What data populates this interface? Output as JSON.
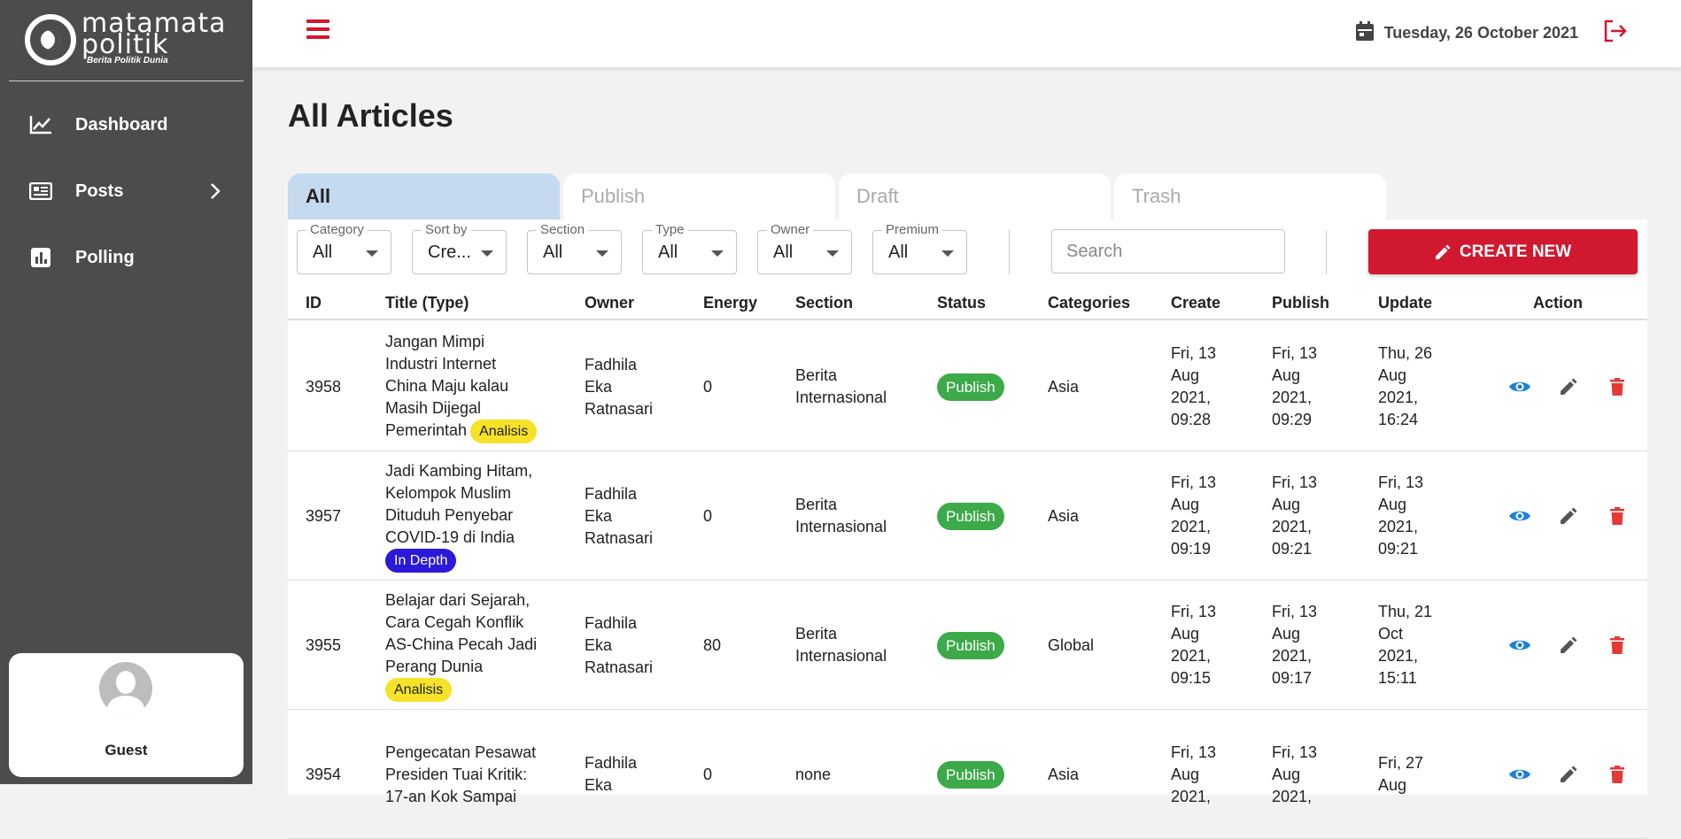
{
  "brand": {
    "name_line1": "matamata",
    "name_line2": "politik",
    "tagline": "Berita Politik Dunia"
  },
  "sidebar": {
    "items": [
      {
        "label": "Dashboard",
        "icon": "chart-line-icon"
      },
      {
        "label": "Posts",
        "icon": "newspaper-icon"
      },
      {
        "label": "Polling",
        "icon": "bar-chart-icon"
      }
    ],
    "user": {
      "name": "Guest"
    }
  },
  "header": {
    "date": "Tuesday, 26 October 2021"
  },
  "page": {
    "title": "All Articles"
  },
  "tabs": [
    {
      "label": "All"
    },
    {
      "label": "Publish"
    },
    {
      "label": "Draft"
    },
    {
      "label": "Trash"
    }
  ],
  "filters": [
    {
      "label": "Category",
      "value": "All"
    },
    {
      "label": "Sort by",
      "value": "Cre..."
    },
    {
      "label": "Section",
      "value": "All"
    },
    {
      "label": "Type",
      "value": "All"
    },
    {
      "label": "Owner",
      "value": "All"
    },
    {
      "label": "Premium",
      "value": "All"
    }
  ],
  "search": {
    "placeholder": "Search"
  },
  "create_label": "CREATE NEW",
  "table": {
    "headers": [
      "ID",
      "Title (Type)",
      "Owner",
      "Energy",
      "Section",
      "Status",
      "Categories",
      "Create",
      "Publish",
      "Update",
      "Action"
    ],
    "rows": [
      {
        "id": "3958",
        "title": [
          "Jangan Mimpi",
          "Industri Internet",
          "China Maju kalau",
          "Masih Dijegal",
          "Pemerintah"
        ],
        "type": "Analisis",
        "owner": [
          "Fadhila",
          "Eka",
          "Ratnasari"
        ],
        "energy": "0",
        "section": [
          "Berita",
          "Internasional"
        ],
        "status": "Publish",
        "category": "Asia",
        "create": [
          "Fri, 13",
          "Aug",
          "2021,",
          "09:28"
        ],
        "publish": [
          "Fri, 13",
          "Aug",
          "2021,",
          "09:29"
        ],
        "update": [
          "Thu, 26",
          "Aug",
          "2021,",
          "16:24"
        ]
      },
      {
        "id": "3957",
        "title": [
          "Jadi Kambing Hitam,",
          "Kelompok Muslim",
          "Dituduh Penyebar",
          "COVID-19 di India"
        ],
        "type": "In Depth",
        "owner": [
          "Fadhila",
          "Eka",
          "Ratnasari"
        ],
        "energy": "0",
        "section": [
          "Berita",
          "Internasional"
        ],
        "status": "Publish",
        "category": "Asia",
        "create": [
          "Fri, 13",
          "Aug",
          "2021,",
          "09:19"
        ],
        "publish": [
          "Fri, 13",
          "Aug",
          "2021,",
          "09:21"
        ],
        "update": [
          "Fri, 13",
          "Aug",
          "2021,",
          "09:21"
        ]
      },
      {
        "id": "3955",
        "title": [
          "Belajar dari Sejarah,",
          "Cara Cegah Konflik",
          "AS-China Pecah Jadi",
          "Perang Dunia"
        ],
        "type": "Analisis",
        "owner": [
          "Fadhila",
          "Eka",
          "Ratnasari"
        ],
        "energy": "80",
        "section": [
          "Berita",
          "Internasional"
        ],
        "status": "Publish",
        "category": "Global",
        "create": [
          "Fri, 13",
          "Aug",
          "2021,",
          "09:15"
        ],
        "publish": [
          "Fri, 13",
          "Aug",
          "2021,",
          "09:17"
        ],
        "update": [
          "Thu, 21",
          "Oct",
          "2021,",
          "15:11"
        ]
      },
      {
        "id": "3954",
        "title": [
          "Pengecatan Pesawat",
          "Presiden Tuai Kritik:",
          "17-an Kok Sampai"
        ],
        "type": "",
        "owner": [
          "Fadhila",
          "Eka"
        ],
        "energy": "0",
        "section": [
          "none"
        ],
        "status": "Publish",
        "category": "Asia",
        "create": [
          "Fri, 13",
          "Aug",
          "2021,"
        ],
        "publish": [
          "Fri, 13",
          "Aug",
          "2021,"
        ],
        "update": [
          "Fri, 27",
          "Aug"
        ]
      }
    ]
  },
  "colors": {
    "brand_red": "#d0182f",
    "sidebar_bg": "#4a4d4c",
    "publish_green": "#3daa4a",
    "view_blue": "#1e7fd8",
    "delete_red": "#e53935",
    "active_tab": "#c5d9ef"
  }
}
